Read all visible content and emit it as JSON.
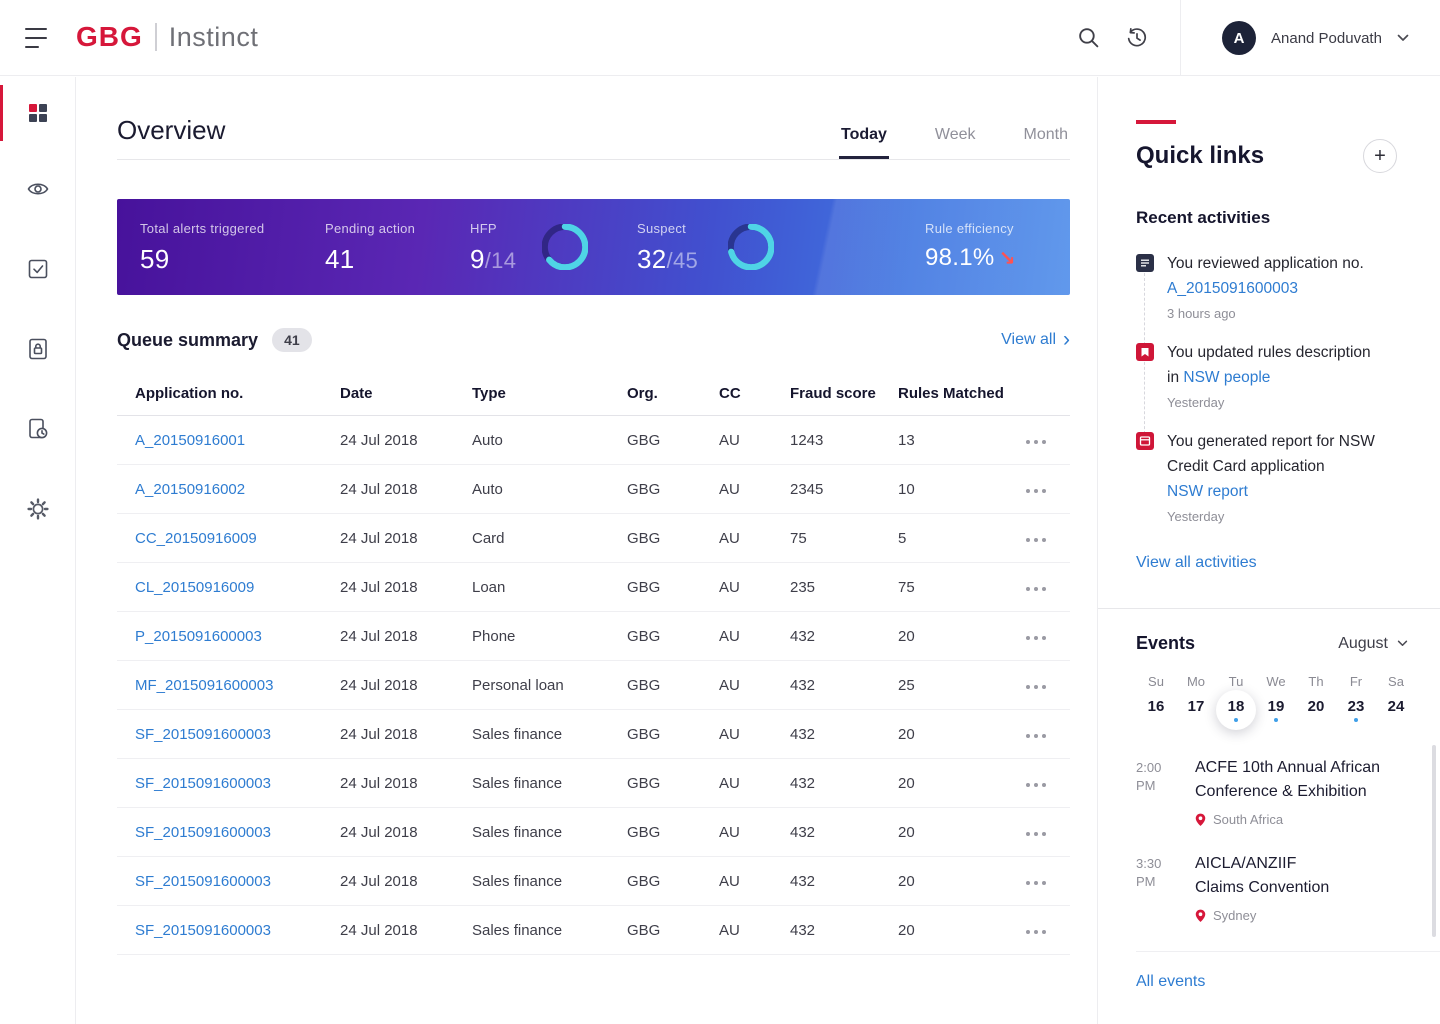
{
  "header": {
    "logo_text": "GBG",
    "logo_product": "Instinct",
    "user_initial": "A",
    "user_name": "Anand Poduvath"
  },
  "overview": {
    "title": "Overview",
    "tabs": [
      {
        "label": "Today"
      },
      {
        "label": "Week"
      },
      {
        "label": "Month"
      }
    ]
  },
  "stats": {
    "total": {
      "label": "Total alerts triggered",
      "value": "59"
    },
    "pending": {
      "label": "Pending action",
      "value": "41"
    },
    "hfp": {
      "label": "HFP",
      "value": "9",
      "of": "/14",
      "pct": 64
    },
    "suspect": {
      "label": "Suspect",
      "value": "32",
      "of": "/45",
      "pct": 71
    },
    "efficiency": {
      "label": "Rule efficiency",
      "value": "98.1%"
    }
  },
  "queue": {
    "title": "Queue summary",
    "badge": "41",
    "view_all": "View all",
    "columns": [
      "Application no.",
      "Date",
      "Type",
      "Org.",
      "CC",
      "Fraud score",
      "Rules Matched"
    ],
    "rows": [
      {
        "app": "A_20150916001",
        "date": "24 Jul 2018",
        "type": "Auto",
        "org": "GBG",
        "cc": "AU",
        "score": "1243",
        "rules": "13"
      },
      {
        "app": "A_20150916002",
        "date": "24 Jul 2018",
        "type": "Auto",
        "org": "GBG",
        "cc": "AU",
        "score": "2345",
        "rules": "10"
      },
      {
        "app": "CC_20150916009",
        "date": "24 Jul 2018",
        "type": "Card",
        "org": "GBG",
        "cc": "AU",
        "score": "75",
        "rules": "5"
      },
      {
        "app": "CL_20150916009",
        "date": "24 Jul 2018",
        "type": "Loan",
        "org": "GBG",
        "cc": "AU",
        "score": "235",
        "rules": "75"
      },
      {
        "app": "P_2015091600003",
        "date": "24 Jul 2018",
        "type": "Phone",
        "org": "GBG",
        "cc": "AU",
        "score": "432",
        "rules": "20"
      },
      {
        "app": "MF_2015091600003",
        "date": "24 Jul 2018",
        "type": "Personal loan",
        "org": "GBG",
        "cc": "AU",
        "score": "432",
        "rules": "25"
      },
      {
        "app": "SF_2015091600003",
        "date": "24 Jul 2018",
        "type": "Sales finance",
        "org": "GBG",
        "cc": "AU",
        "score": "432",
        "rules": "20"
      },
      {
        "app": "SF_2015091600003",
        "date": "24 Jul 2018",
        "type": "Sales finance",
        "org": "GBG",
        "cc": "AU",
        "score": "432",
        "rules": "20"
      },
      {
        "app": "SF_2015091600003",
        "date": "24 Jul 2018",
        "type": "Sales finance",
        "org": "GBG",
        "cc": "AU",
        "score": "432",
        "rules": "20"
      },
      {
        "app": "SF_2015091600003",
        "date": "24 Jul 2018",
        "type": "Sales finance",
        "org": "GBG",
        "cc": "AU",
        "score": "432",
        "rules": "20"
      },
      {
        "app": "SF_2015091600003",
        "date": "24 Jul 2018",
        "type": "Sales finance",
        "org": "GBG",
        "cc": "AU",
        "score": "432",
        "rules": "20"
      }
    ]
  },
  "quick_links": {
    "title": "Quick links",
    "recent_title": "Recent activities",
    "activities": [
      {
        "line1": "You reviewed application no.",
        "link": "A_2015091600003",
        "time": "3 hours ago"
      },
      {
        "line1": "You updated rules description",
        "pre": "in",
        "link": "NSW people",
        "time": "Yesterday"
      },
      {
        "line1": "You generated report for NSW",
        "line2": "Credit Card application",
        "link": "NSW report",
        "time": "Yesterday"
      }
    ],
    "view_all": "View all activities"
  },
  "events": {
    "title": "Events",
    "month": "August",
    "days": [
      {
        "dow": "Su",
        "day": "16"
      },
      {
        "dow": "Mo",
        "day": "17"
      },
      {
        "dow": "Tu",
        "day": "18"
      },
      {
        "dow": "We",
        "day": "19"
      },
      {
        "dow": "Th",
        "day": "20"
      },
      {
        "dow": "Fr",
        "day": "23"
      },
      {
        "dow": "Sa",
        "day": "24"
      }
    ],
    "list": [
      {
        "time": "2:00 PM",
        "title1": "ACFE 10th Annual African",
        "title2": "Conference & Exhibition",
        "location": "South Africa"
      },
      {
        "time": "3:30 PM",
        "title1": "AICLA/ANZIIF",
        "title2": "Claims Convention",
        "location": "Sydney"
      }
    ],
    "all_events": "All events"
  },
  "icons": {
    "plus": "+",
    "chevron_right": "›",
    "trend_down": "↘"
  },
  "colors": {
    "brand_red": "#d6173a",
    "link_blue": "#2e7cd1",
    "donut_cyan": "#4fd4e6",
    "banner_purple": "#47129b",
    "banner_blue": "#4f8dea"
  }
}
